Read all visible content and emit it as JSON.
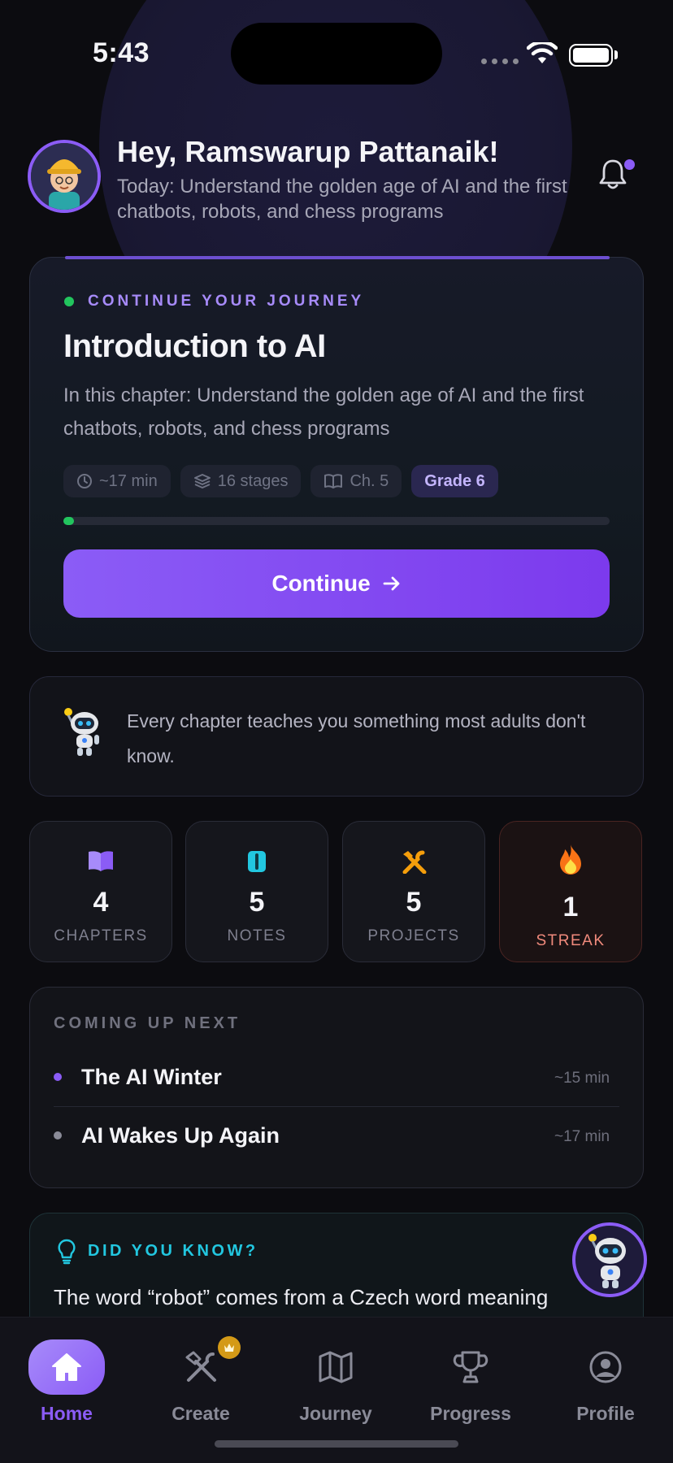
{
  "status_bar": {
    "time": "5:43"
  },
  "header": {
    "greeting": "Hey, Ramswarup Pattanaik!",
    "subtitle": "Today: Understand the golden age of AI and the first chatbots, robots, and chess programs",
    "notification_dot": true
  },
  "journey": {
    "eyebrow": "CONTINUE YOUR JOURNEY",
    "title": "Introduction to AI",
    "description": "In this chapter: Understand the golden age of AI and the first chatbots, robots, and chess programs",
    "chips": {
      "duration": "~17 min",
      "stages": "16 stages",
      "chapter": "Ch. 5",
      "grade": "Grade 6"
    },
    "progress_fraction": 0.02,
    "button_label": "Continue"
  },
  "tip": {
    "text": "Every chapter teaches you something most adults don't know."
  },
  "stats": [
    {
      "icon": "book-icon",
      "value": "4",
      "label": "CHAPTERS",
      "color": "#a78bfa"
    },
    {
      "icon": "notes-icon",
      "value": "5",
      "label": "NOTES",
      "color": "#22c7e0"
    },
    {
      "icon": "tools-icon",
      "value": "5",
      "label": "PROJECTS",
      "color": "#f59e0b"
    },
    {
      "icon": "fire-icon",
      "value": "1",
      "label": "STREAK",
      "color": "#f97316"
    }
  ],
  "coming_up": {
    "heading": "COMING UP NEXT",
    "items": [
      {
        "title": "The AI Winter",
        "time": "~15 min",
        "dot_color": "#8b5cf6"
      },
      {
        "title": "AI Wakes Up Again",
        "time": "~17 min",
        "dot_color": "#8a8b98"
      }
    ]
  },
  "did_you_know": {
    "heading": "DID YOU KNOW?",
    "text": "The word “robot” comes from a Czech word meaning"
  },
  "tabs": [
    {
      "label": "Home",
      "icon": "home-icon",
      "active": true
    },
    {
      "label": "Create",
      "icon": "hammer-wrench-icon",
      "active": false
    },
    {
      "label": "Journey",
      "icon": "map-icon",
      "active": false
    },
    {
      "label": "Progress",
      "icon": "trophy-icon",
      "active": false
    },
    {
      "label": "Profile",
      "icon": "user-circle-icon",
      "active": false
    }
  ],
  "colors": {
    "accent": "#8b5cf6",
    "success": "#22c55e",
    "cyan": "#22c7e0"
  }
}
